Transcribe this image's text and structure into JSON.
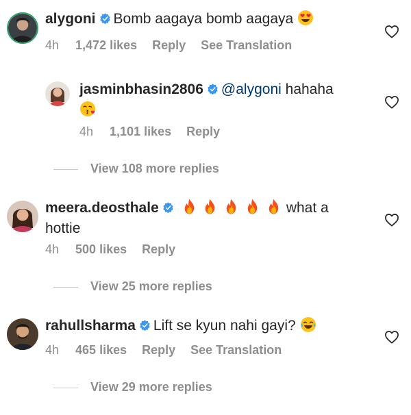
{
  "comments": [
    {
      "username": "alygoni",
      "text": "Bomb aagaya bomb aagaya",
      "time": "4h",
      "likes": "1,472 likes",
      "reply": "Reply",
      "translate": "See Translation"
    },
    {
      "username": "jasminbhasin2806",
      "mention": "@alygoni",
      "text": "hahaha",
      "time": "4h",
      "likes": "1,101 likes",
      "reply": "Reply"
    },
    {
      "username": "meera.deosthale",
      "text_after": "what a",
      "text_line2": "hottie",
      "time": "4h",
      "likes": "500 likes",
      "reply": "Reply"
    },
    {
      "username": "rahullsharma",
      "text": "Lift se kyun nahi gayi?",
      "time": "4h",
      "likes": "465 likes",
      "reply": "Reply",
      "translate": "See Translation"
    }
  ],
  "view_more": [
    "View 108 more replies",
    "View 25 more replies",
    "View 29 more replies"
  ],
  "icons": {
    "verified": "verified-badge-icon",
    "like": "heart-outline-icon"
  },
  "colors": {
    "verified": "#3897f0",
    "text": "#262626",
    "secondary": "#8e8e8e",
    "mention": "#00376b"
  }
}
